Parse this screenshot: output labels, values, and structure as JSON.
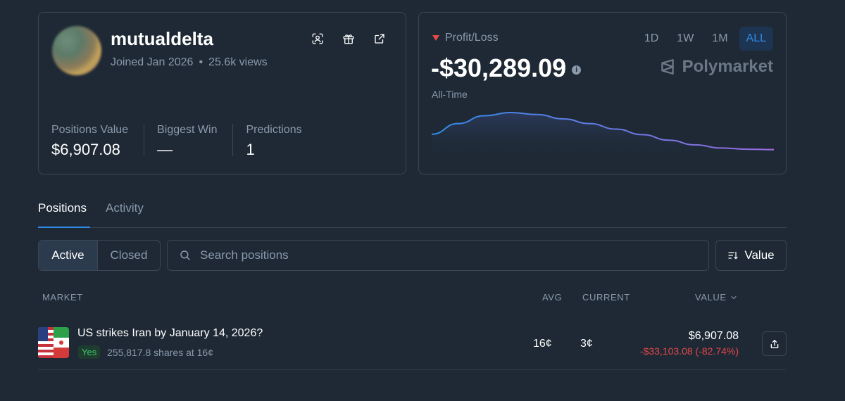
{
  "profile": {
    "username": "mutualdelta",
    "joined": "Joined Jan 2026",
    "views": "25.6k views",
    "separator": "•",
    "icons": [
      "face-scan-icon",
      "gift-icon",
      "external-link-icon"
    ],
    "stats": [
      {
        "label": "Positions Value",
        "value": "$6,907.08"
      },
      {
        "label": "Biggest Win",
        "value": "—"
      },
      {
        "label": "Predictions",
        "value": "1"
      }
    ]
  },
  "pnl": {
    "label": "Profit/Loss",
    "value": "-$30,289.09",
    "info": "i",
    "period": "All-Time",
    "ranges": [
      "1D",
      "1W",
      "1M",
      "ALL"
    ],
    "active_range": "ALL",
    "brand": "Polymarket",
    "trend_color": "#e54848",
    "chart_line_colors": [
      "#2f8ae6",
      "#9b6be0"
    ],
    "chart_series": [
      0.45,
      0.72,
      0.92,
      1.0,
      0.95,
      0.84,
      0.72,
      0.58,
      0.44,
      0.3,
      0.18,
      0.1,
      0.07,
      0.06
    ]
  },
  "tabs": {
    "positions": "Positions",
    "activity": "Activity"
  },
  "filters": {
    "active": "Active",
    "closed": "Closed",
    "search_placeholder": "Search positions",
    "sort_label": "Value"
  },
  "table": {
    "headers": {
      "market": "MARKET",
      "avg": "AVG",
      "current": "CURRENT",
      "value": "VALUE"
    },
    "rows": [
      {
        "title": "US strikes Iran by January 14, 2026?",
        "outcome": "Yes",
        "shares": "255,817.8 shares at 16¢",
        "avg": "16¢",
        "current": "3¢",
        "value": "$6,907.08",
        "change": "-$33,103.08 (-82.74%)"
      }
    ]
  },
  "colors": {
    "background": "#1e2935",
    "accent": "#2f8ae6",
    "positive": "#3ec46d",
    "negative": "#e54848"
  }
}
